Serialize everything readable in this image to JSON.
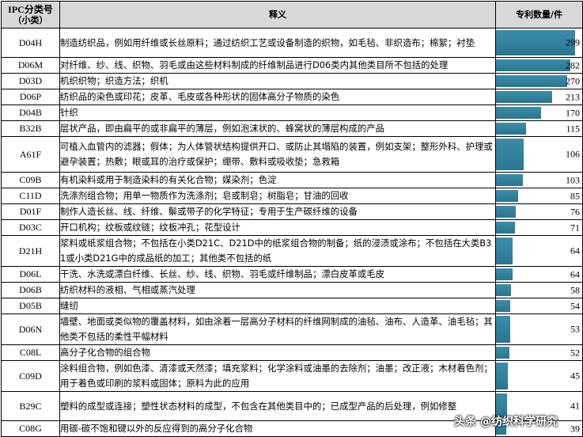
{
  "header": {
    "code_line1": "IPC分类号",
    "code_line2": "（小类）",
    "desc": "释义",
    "count": "专利数量/件"
  },
  "rows": [
    {
      "code": "D04H",
      "desc": "制造纺织品，例如用纤维或长丝原料；通过纺织工艺或设备制造的织物，如毛毡、非织造布；棉絮；衬垫",
      "count": 299
    },
    {
      "code": "D06M",
      "desc": "对纤维、纱、线、织物、羽毛或由这些材料制成的纤维制品进行D06类内其他类目所不包括的处理",
      "count": 282
    },
    {
      "code": "D03D",
      "desc": "机织织物；织造方法；织机",
      "count": 270
    },
    {
      "code": "D06P",
      "desc": "纺织品的染色或印花；皮革、毛皮或各种形状的固体高分子物质的染色",
      "count": 213
    },
    {
      "code": "D04B",
      "desc": "针织",
      "count": 170
    },
    {
      "code": "B32B",
      "desc": "层状产品，即由扁平的或非扁平的薄层，例如泡沫状的、蜂窝状的薄层构成的产品",
      "count": 115
    },
    {
      "code": "A61F",
      "desc": "可植入血管内的滤器；假体；为人体管状结构提供开口、或防止其塌陷的装置，例如支架；整形外科、护理或避孕装置；热敷；眼或耳的治疗或保护；绷带、敷料或吸收垫；急救箱",
      "count": 106
    },
    {
      "code": "C09B",
      "desc": "有机染料或用于制造染料的有关化合物；媒染剂；色淀",
      "count": 103
    },
    {
      "code": "C11D",
      "desc": "洗涤剂组合物；用单一物质作为洗涤剂；皂或制皂；树脂皂；甘油的回收",
      "count": 85
    },
    {
      "code": "D01F",
      "desc": "制作人造长丝、线、纤维、鬃或带子的化学特征；专用于生产碳纤维的设备",
      "count": 76
    },
    {
      "code": "D03C",
      "desc": "开口机构；纹板或纹链；纹板冲孔；花型设计",
      "count": 71
    },
    {
      "code": "D21H",
      "desc": "浆料或纸浆组合物；不包括在小类D21C、D21D中的纸浆组合物的制备；纸的浸渍或涂布；不包括在大类B31或小类D21G中的成品纸的加工；其他类不包括的纸",
      "count": 64
    },
    {
      "code": "D06L",
      "desc": "干洗、水洗或漂白纤维、长丝、纱、线、织物、羽毛或纤维制品；漂白皮革或毛皮",
      "count": 64
    },
    {
      "code": "D06B",
      "desc": "纺织材料的液相、气相或蒸汽处理",
      "count": 58
    },
    {
      "code": "D05B",
      "desc": "缝纫",
      "count": 54
    },
    {
      "code": "D06N",
      "desc": "墙壁、地面或类似物的覆盖材料，如由涂着一层高分子材料的纤维网制成的油毡、油布、人造革、油毛毡；其他类不包括的柔性平幅材料",
      "count": 53
    },
    {
      "code": "C08L",
      "desc": "高分子化合物的组合物",
      "count": 52
    },
    {
      "code": "C09D",
      "desc": "涂料组合物，例如色漆、清漆或天然漆；填充浆料；化学涂料或油墨的去除剂；油墨；改正液；木材着色剂；用于着色或印刷的浆料或固体；原料为此的应用",
      "count": 45
    },
    {
      "code": "B29C",
      "desc": "塑料的成型或连接；塑性状态材料的成型，不包含在其他类目中的；已成型产品的后处理，例如修整",
      "count": 41
    },
    {
      "code": "C08G",
      "desc": "用碳-碳不饱和键以外的反应得到的高分子化合物",
      "count": 39
    }
  ],
  "bar_max": 299,
  "bar_color": "#2f7d98",
  "watermark": "头条 @纺织科学研究"
}
